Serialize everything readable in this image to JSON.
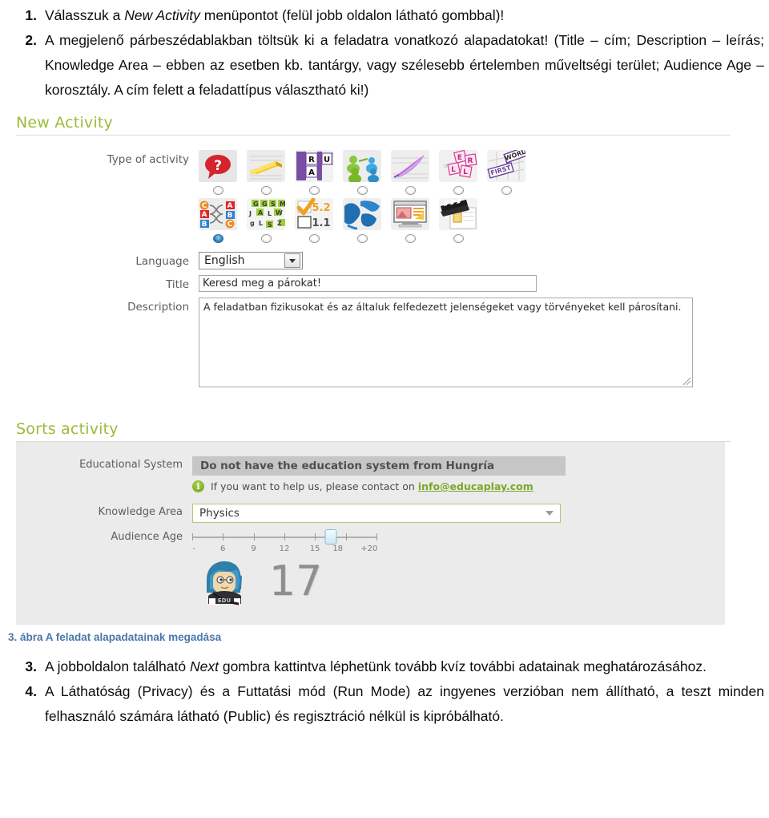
{
  "doc": {
    "top_items": [
      {
        "num": "1.",
        "parts": [
          {
            "t": "Válasszuk a ",
            "i": false
          },
          {
            "t": "New Activity",
            "i": true
          },
          {
            "t": " menüpontot (felül jobb oldalon látható gombbal)!",
            "i": false
          }
        ]
      },
      {
        "num": "2.",
        "parts": [
          {
            "t": "A megjelenő párbeszédablakban töltsük ki a feladatra vonatkozó alapadatokat! (Title – cím; Description – leírás; Knowledge Area – ebben az esetben kb. tantárgy, vagy szélesebb értelemben műveltségi terület; Audience Age – korosztály. A cím felett a feladattípus választható ki!)",
            "i": false
          }
        ]
      }
    ],
    "caption": "3. ábra A feladat alapadatainak megadása",
    "bottom_items": [
      {
        "num": "3.",
        "parts": [
          {
            "t": "A jobboldalon található ",
            "i": false
          },
          {
            "t": "Next",
            "i": true
          },
          {
            "t": " gombra kattintva léphetünk tovább kvíz további adatainak meghatározásához.",
            "i": false
          }
        ]
      },
      {
        "num": "4.",
        "parts": [
          {
            "t": "A Láthatóság (Privacy) és a Futtatási mód (Run Mode) az ingyenes verzióban nem állítható, a teszt minden felhasználó számára látható (Public) és regisztráció nélkül is kipróbálható.",
            "i": false
          }
        ]
      }
    ]
  },
  "new_activity": {
    "title": "New Activity",
    "type_label": "Type of activity",
    "icons": [
      {
        "name": "quiz-icon",
        "selected": false
      },
      {
        "name": "fill-in-blanks-icon",
        "selected": false
      },
      {
        "name": "crossword-icon",
        "selected": false
      },
      {
        "name": "matching-columns-icon",
        "selected": false
      },
      {
        "name": "dictation-icon",
        "selected": false
      },
      {
        "name": "word-jumble-icon",
        "selected": false
      },
      {
        "name": "word-search-icon",
        "selected": false
      },
      {
        "name": "matching-pairs-icon",
        "selected": true
      },
      {
        "name": "alphabet-soup-icon",
        "selected": false
      },
      {
        "name": "test-icon",
        "selected": false
      },
      {
        "name": "map-quiz-icon",
        "selected": false
      },
      {
        "name": "slideshow-icon",
        "selected": false
      },
      {
        "name": "video-quiz-icon",
        "selected": false
      }
    ],
    "language_label": "Language",
    "language_value": "English",
    "title_label": "Title",
    "title_value": "Keresd meg a párokat!",
    "description_label": "Description",
    "description_value": "A feladatban fizikusokat és az általuk felfedezett jelenségeket vagy törvényeket kell párosítani."
  },
  "sorts_activity": {
    "title": "Sorts activity",
    "edu_system_label": "Educational System",
    "edu_system_value": "Do not have the education system from Hungría",
    "info_text": "If you want to help us, please contact on",
    "info_email": "info@educaplay.com",
    "info_icon": "info-circle-icon",
    "knowledge_area_label": "Knowledge Area",
    "knowledge_area_value": "Physics",
    "audience_age_label": "Audience Age",
    "age_ticks": [
      "-",
      "6",
      "9",
      "12",
      "15",
      "18",
      "+20"
    ],
    "age_value": "17",
    "avatar_name": "user-avatar"
  },
  "colors": {
    "panel_title": "#9bbb3a",
    "panel_bg": "#ebebeb",
    "caption": "#4a76a8",
    "link_green": "#7aa829",
    "selected_radio": "#1d6fa5"
  }
}
